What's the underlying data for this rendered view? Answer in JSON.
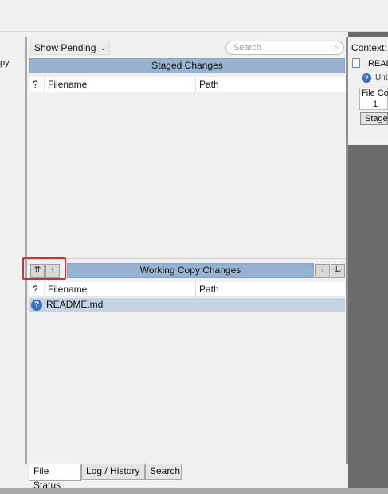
{
  "left_pane": {
    "partial_text": "py"
  },
  "toolbar": {
    "show_pending_label": "Show Pending",
    "search_placeholder": "Search"
  },
  "staged": {
    "header": "Staged Changes",
    "columns": {
      "status": "?",
      "filename": "Filename",
      "path": "Path"
    }
  },
  "working": {
    "header": "Working Copy Changes",
    "columns": {
      "status": "?",
      "filename": "Filename",
      "path": "Path"
    },
    "files": [
      {
        "status": "?",
        "name": "README.md",
        "path": ""
      }
    ]
  },
  "tabs": [
    {
      "label": "File Status",
      "selected": true
    },
    {
      "label": "Log / History",
      "selected": false
    },
    {
      "label": "Search",
      "selected": false
    }
  ],
  "context": {
    "label": "Context:",
    "file_name": "READ",
    "status": "Unt",
    "column_header": "File Co",
    "column_value": "1",
    "stage_button": "Stage"
  },
  "icons": {
    "show_pending_chevron": "chevron-down-icon",
    "search": "magnifier-icon",
    "unstage_all": "double-arrow-up-icon",
    "unstage": "arrow-up-icon",
    "stage": "arrow-down-icon",
    "stage_all": "double-arrow-down-icon",
    "untracked": "question-mark-icon"
  },
  "colors": {
    "section_header": "#98b3d1",
    "selected_row": "#c5d4e2",
    "highlight_border": "#e0282d",
    "right_pane": "#6b6b6b"
  }
}
